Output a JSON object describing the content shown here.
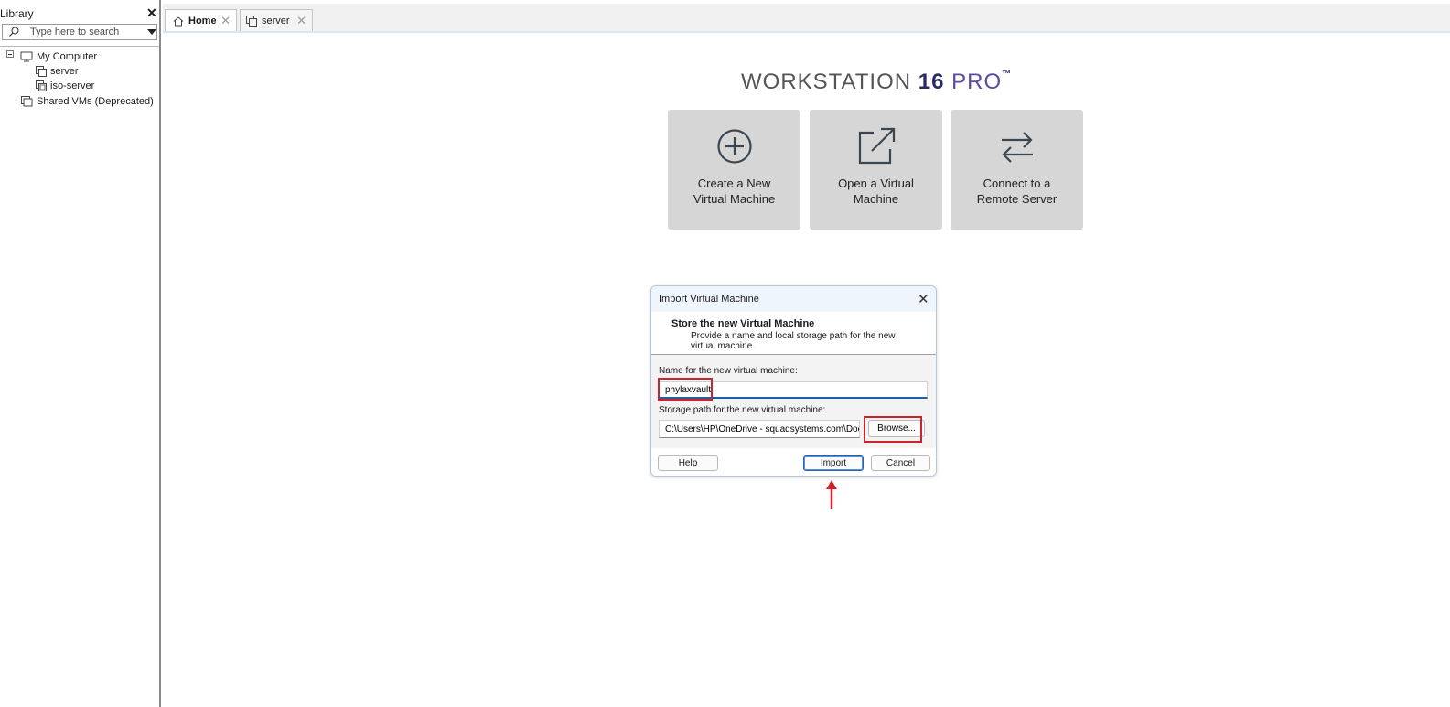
{
  "library": {
    "title": "Library",
    "close": "✕",
    "search_placeholder": "Type here to search",
    "tree": [
      {
        "label": "My Computer"
      },
      {
        "label": "server"
      },
      {
        "label": "iso-server"
      },
      {
        "label": "Shared VMs (Deprecated)"
      }
    ]
  },
  "tabs": [
    {
      "label": "Home",
      "close": "✕"
    },
    {
      "label": "server",
      "close": "✕"
    }
  ],
  "home": {
    "brand_word": "WORKSTATION ",
    "brand_version": "16",
    "brand_edition": " PRO",
    "brand_tm": "™",
    "tiles": [
      {
        "line1": "Create a New",
        "line2": "Virtual Machine",
        "icon": "plus-circle-icon"
      },
      {
        "line1": "Open a Virtual",
        "line2": "Machine",
        "icon": "open-external-icon"
      },
      {
        "line1": "Connect to a",
        "line2": "Remote Server",
        "icon": "swap-arrows-icon"
      }
    ]
  },
  "dialog": {
    "title": "Import Virtual Machine",
    "close": "✕",
    "heading": "Store the new Virtual Machine",
    "description": "Provide a name and local storage path for the new virtual machine.",
    "name_label": "Name for the new virtual machine:",
    "name_value": "phylaxvault",
    "path_label": "Storage path for the new virtual machine:",
    "path_value": "C:\\Users\\HP\\OneDrive - squadsystems.com\\Docu",
    "browse": "Browse...",
    "help": "Help",
    "import": "Import",
    "cancel": "Cancel"
  },
  "colors": {
    "highlight": "#d0202a",
    "tile_bg": "#d6d6d6",
    "brand_version": "#2b2a63"
  }
}
